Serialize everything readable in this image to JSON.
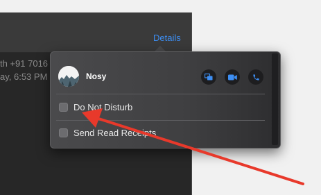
{
  "header": {
    "details_label": "Details"
  },
  "background_text": {
    "line1": "th +91 7016",
    "line2": "ay, 6:53 PM"
  },
  "popover": {
    "contact_name": "Nosy",
    "actions": [
      {
        "icon": "screen-share-icon"
      },
      {
        "icon": "video-camera-icon"
      },
      {
        "icon": "phone-icon"
      }
    ],
    "options": [
      {
        "label": "Do Not Disturb",
        "checked": false
      },
      {
        "label": "Send Read Receipts",
        "checked": false
      }
    ]
  },
  "colors": {
    "accent": "#3d8ef3",
    "annotation_arrow": "#e8392b",
    "popover_bg": "#404042"
  }
}
